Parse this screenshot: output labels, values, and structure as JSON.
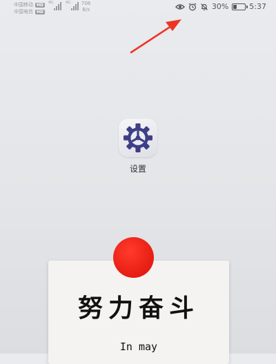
{
  "status_bar": {
    "carrier1": "中国移动",
    "carrier2": "中国电信",
    "hd_badge": "HD",
    "signal_tag": "4G",
    "net_speed_value": "706",
    "net_speed_unit": "B/s",
    "battery_percent": "30%",
    "battery_level": 0.3,
    "time": "5:37"
  },
  "home": {
    "app_label": "设置",
    "app_icon": "gear-icon"
  },
  "card": {
    "title": "努力奋斗",
    "subtitle": "In may"
  },
  "colors": {
    "accent_red": "#e61d12",
    "arrow_red": "#ee3524",
    "icon_gear": "#3f3f86"
  }
}
